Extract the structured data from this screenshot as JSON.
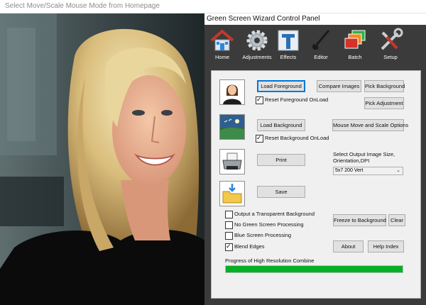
{
  "window": {
    "title": "Select Move/Scale Mouse Mode from Homepage"
  },
  "panel": {
    "title": "Green Screen Wizard Control Panel"
  },
  "toolbar": {
    "items": [
      {
        "label": "Home",
        "icon": "house-icon"
      },
      {
        "label": "Adjustments",
        "icon": "gear-icon"
      },
      {
        "label": "Effects",
        "icon": "effects-icon"
      },
      {
        "label": "Editor",
        "icon": "brush-icon"
      },
      {
        "label": "Batch",
        "icon": "batch-layers-icon"
      },
      {
        "label": "Setup",
        "icon": "tools-icon"
      }
    ]
  },
  "foreground": {
    "load_label": "Load Foreground",
    "reset_label": "Reset Foreground OnLoad",
    "reset_checked": true
  },
  "buttons": {
    "compare": "Compare Images",
    "pick_background": "Pick Background",
    "pick_adjustment": "Pick Adjustment",
    "mouse_move": "Mouse Move and Scale Options",
    "print": "Print",
    "save": "Save",
    "freeze": "Freeze to Background",
    "clear": "Clear",
    "about": "About",
    "help": "Help Index"
  },
  "background": {
    "load_label": "Load Background",
    "reset_label": "Reset Background OnLoad",
    "reset_checked": true
  },
  "output": {
    "size_label": "Select Output Image Size, Orientation,DPI",
    "size_value": "5x7 200 Vert"
  },
  "options": [
    {
      "label": "Output a Transparent Background",
      "checked": false
    },
    {
      "label": "No Green Screen Processing",
      "checked": false
    },
    {
      "label": "Blue Screen Processing",
      "checked": false
    },
    {
      "label": "Blend Edges",
      "checked": true
    }
  ],
  "progress": {
    "label": "Progress of High Resolution Combine",
    "value": 1.0,
    "color": "#06b025"
  },
  "colors": {
    "toolbar_bg": "#3b3b3b",
    "panel_bg": "#f0f0f0",
    "focus_border": "#0078d7"
  }
}
